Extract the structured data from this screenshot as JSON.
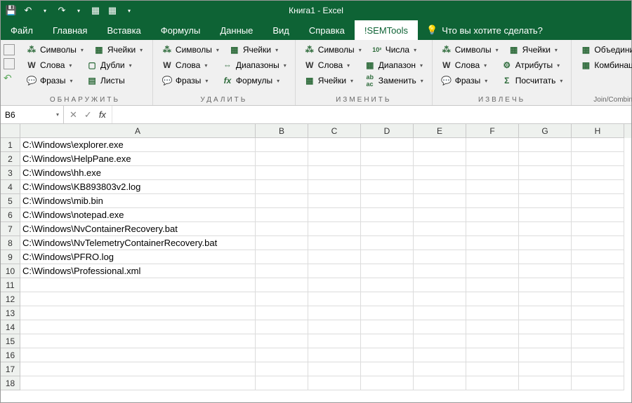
{
  "title": "Книга1 - Excel",
  "menu": {
    "file": "Файл",
    "home": "Главная",
    "insert": "Вставка",
    "formulas": "Формулы",
    "data": "Данные",
    "view": "Вид",
    "help": "Справка",
    "semtools": "!SEMTools",
    "tell": "Что вы хотите сделать?"
  },
  "ribbon": {
    "groups": {
      "detect": "ОБНАРУЖИТЬ",
      "delete": "УДАЛИТЬ",
      "change": "ИЗМЕНИТЬ",
      "extract": "ИЗВЛЕЧЬ",
      "join": "Join/Combine"
    },
    "btns": {
      "symbols": "Символы",
      "words": "Слова",
      "phrases": "Фразы",
      "cells": "Ячейки",
      "dupes": "Дубли",
      "sheets": "Листы",
      "ranges": "Диапазоны",
      "formulas": "Формулы",
      "range": "Диапазон",
      "numbers": "Числа",
      "replace": "Заменить",
      "attrs": "Атрибуты",
      "count": "Посчитать",
      "merge": "Объединить",
      "combos": "Комбинации"
    }
  },
  "name_box": "B6",
  "columns": [
    "A",
    "B",
    "C",
    "D",
    "E",
    "F",
    "G",
    "H"
  ],
  "rows": [
    {
      "n": 1,
      "a": "C:\\Windows\\explorer.exe"
    },
    {
      "n": 2,
      "a": "C:\\Windows\\HelpPane.exe"
    },
    {
      "n": 3,
      "a": "C:\\Windows\\hh.exe"
    },
    {
      "n": 4,
      "a": "C:\\Windows\\KB893803v2.log"
    },
    {
      "n": 5,
      "a": "C:\\Windows\\mib.bin"
    },
    {
      "n": 6,
      "a": "C:\\Windows\\notepad.exe"
    },
    {
      "n": 7,
      "a": "C:\\Windows\\NvContainerRecovery.bat"
    },
    {
      "n": 8,
      "a": "C:\\Windows\\NvTelemetryContainerRecovery.bat"
    },
    {
      "n": 9,
      "a": "C:\\Windows\\PFRO.log"
    },
    {
      "n": 10,
      "a": "C:\\Windows\\Professional.xml"
    },
    {
      "n": 11,
      "a": ""
    },
    {
      "n": 12,
      "a": ""
    },
    {
      "n": 13,
      "a": ""
    },
    {
      "n": 14,
      "a": ""
    },
    {
      "n": 15,
      "a": ""
    },
    {
      "n": 16,
      "a": ""
    },
    {
      "n": 17,
      "a": ""
    },
    {
      "n": 18,
      "a": ""
    }
  ]
}
